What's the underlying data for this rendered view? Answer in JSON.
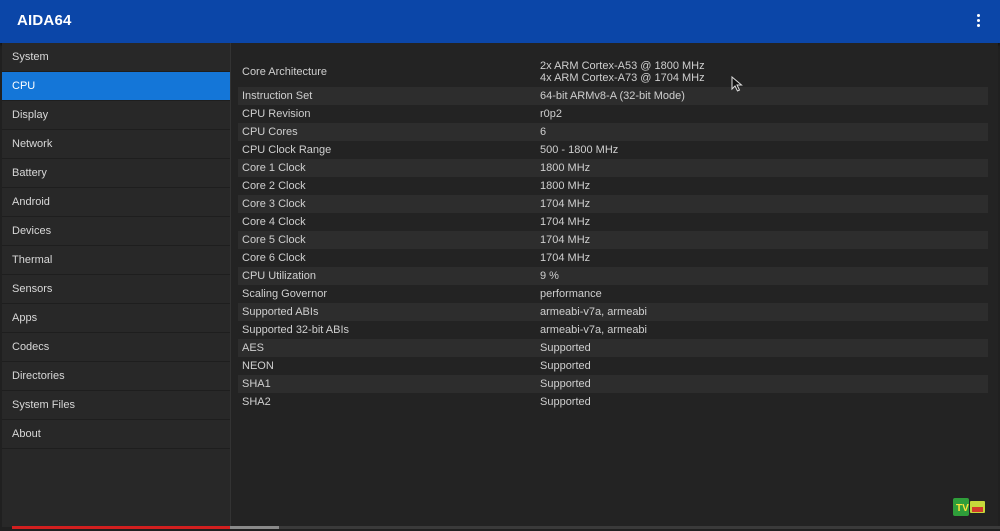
{
  "app": {
    "title": "AIDA64",
    "menu_icon": "more-vert-icon"
  },
  "colors": {
    "appbar": "#0b46a8",
    "active_item": "#1476d8",
    "background": "#232323",
    "progress": "#d21f1f"
  },
  "sidebar": {
    "items": [
      {
        "label": "System"
      },
      {
        "label": "CPU",
        "active": true
      },
      {
        "label": "Display"
      },
      {
        "label": "Network"
      },
      {
        "label": "Battery"
      },
      {
        "label": "Android"
      },
      {
        "label": "Devices"
      },
      {
        "label": "Thermal"
      },
      {
        "label": "Sensors"
      },
      {
        "label": "Apps"
      },
      {
        "label": "Codecs"
      },
      {
        "label": "Directories"
      },
      {
        "label": "System Files"
      },
      {
        "label": "About"
      }
    ]
  },
  "cpu": {
    "rows": [
      {
        "key": "Core Architecture",
        "value": [
          "2x ARM Cortex-A53 @ 1800 MHz",
          "4x ARM Cortex-A73 @ 1704 MHz"
        ]
      },
      {
        "key": "Instruction Set",
        "value": [
          "64-bit ARMv8-A (32-bit Mode)"
        ]
      },
      {
        "key": "CPU Revision",
        "value": [
          "r0p2"
        ]
      },
      {
        "key": "CPU Cores",
        "value": [
          "6"
        ]
      },
      {
        "key": "CPU Clock Range",
        "value": [
          "500 - 1800 MHz"
        ]
      },
      {
        "key": "Core 1 Clock",
        "value": [
          "1800 MHz"
        ]
      },
      {
        "key": "Core 2 Clock",
        "value": [
          "1800 MHz"
        ]
      },
      {
        "key": "Core 3 Clock",
        "value": [
          "1704 MHz"
        ]
      },
      {
        "key": "Core 4 Clock",
        "value": [
          "1704 MHz"
        ]
      },
      {
        "key": "Core 5 Clock",
        "value": [
          "1704 MHz"
        ]
      },
      {
        "key": "Core 6 Clock",
        "value": [
          "1704 MHz"
        ]
      },
      {
        "key": "CPU Utilization",
        "value": [
          "9 %"
        ]
      },
      {
        "key": "Scaling Governor",
        "value": [
          "performance"
        ]
      },
      {
        "key": "Supported ABIs",
        "value": [
          "armeabi-v7a, armeabi"
        ]
      },
      {
        "key": "Supported 32-bit ABIs",
        "value": [
          "armeabi-v7a, armeabi"
        ]
      },
      {
        "key": "AES",
        "value": [
          "Supported"
        ]
      },
      {
        "key": "NEON",
        "value": [
          "Supported"
        ]
      },
      {
        "key": "SHA1",
        "value": [
          "Supported"
        ]
      },
      {
        "key": "SHA2",
        "value": [
          "Supported"
        ]
      }
    ]
  },
  "video_progress": {
    "played_fraction": 0.22,
    "buffered_fraction": 0.27
  },
  "watermark_icon": "tv-logo-icon",
  "cursor_icon": "mouse-pointer-icon"
}
